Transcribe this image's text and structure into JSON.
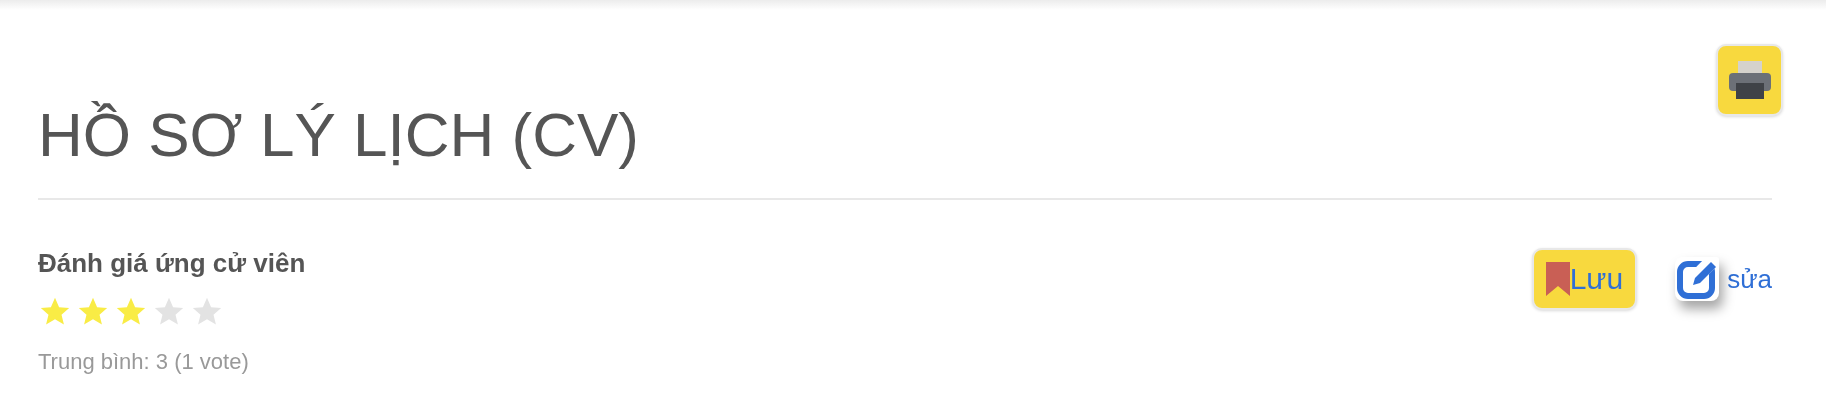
{
  "title": "HỒ SƠ LÝ LỊCH (CV)",
  "rating": {
    "heading": "Đánh giá ứng cử viên",
    "stars": 3,
    "summary": "Trung bình: 3 (1 vote)"
  },
  "actions": [
    {
      "kind": "save",
      "label": "Lưu"
    },
    {
      "kind": "edit",
      "label": "sửa"
    }
  ]
}
